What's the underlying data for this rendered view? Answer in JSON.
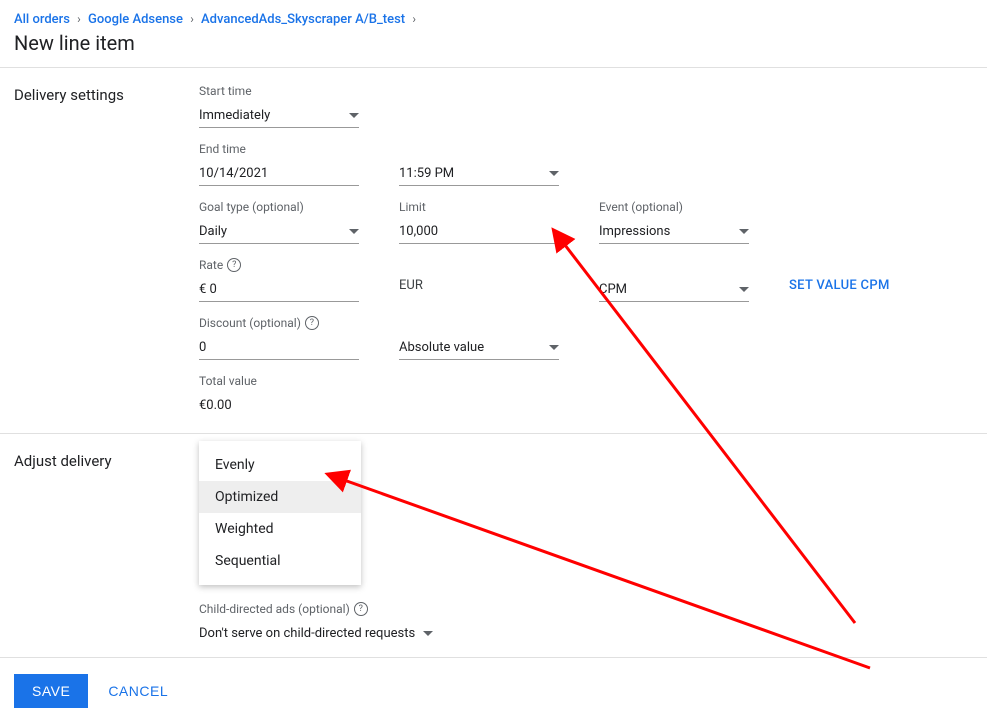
{
  "breadcrumbs": {
    "items": [
      "All orders",
      "Google Adsense",
      "AdvancedAds_Skyscraper A/B_test"
    ]
  },
  "page_title": "New line item",
  "sections": {
    "delivery": {
      "label": "Delivery settings",
      "start_time": {
        "label": "Start time",
        "value": "Immediately"
      },
      "end_time": {
        "label": "End time",
        "date": "10/14/2021",
        "time": "11:59 PM"
      },
      "goal_type": {
        "label": "Goal type (optional)",
        "value": "Daily"
      },
      "limit": {
        "label": "Limit",
        "value": "10,000"
      },
      "event": {
        "label": "Event (optional)",
        "value": "Impressions"
      },
      "rate": {
        "label": "Rate",
        "value": "€ 0"
      },
      "currency": "EUR",
      "pricing": {
        "value": "CPM"
      },
      "set_value_cpm": "SET VALUE CPM",
      "discount": {
        "label": "Discount (optional)",
        "value": "0"
      },
      "discount_type": {
        "value": "Absolute value"
      },
      "total": {
        "label": "Total value",
        "value": "€0.00"
      }
    },
    "adjust": {
      "label": "Adjust delivery",
      "child_directed": {
        "label": "Child-directed ads (optional)",
        "value": "Don't serve on child-directed requests"
      }
    }
  },
  "popup": {
    "items": [
      "Evenly",
      "Optimized",
      "Weighted",
      "Sequential"
    ],
    "selected_index": 1
  },
  "footer": {
    "save": "SAVE",
    "cancel": "CANCEL"
  }
}
